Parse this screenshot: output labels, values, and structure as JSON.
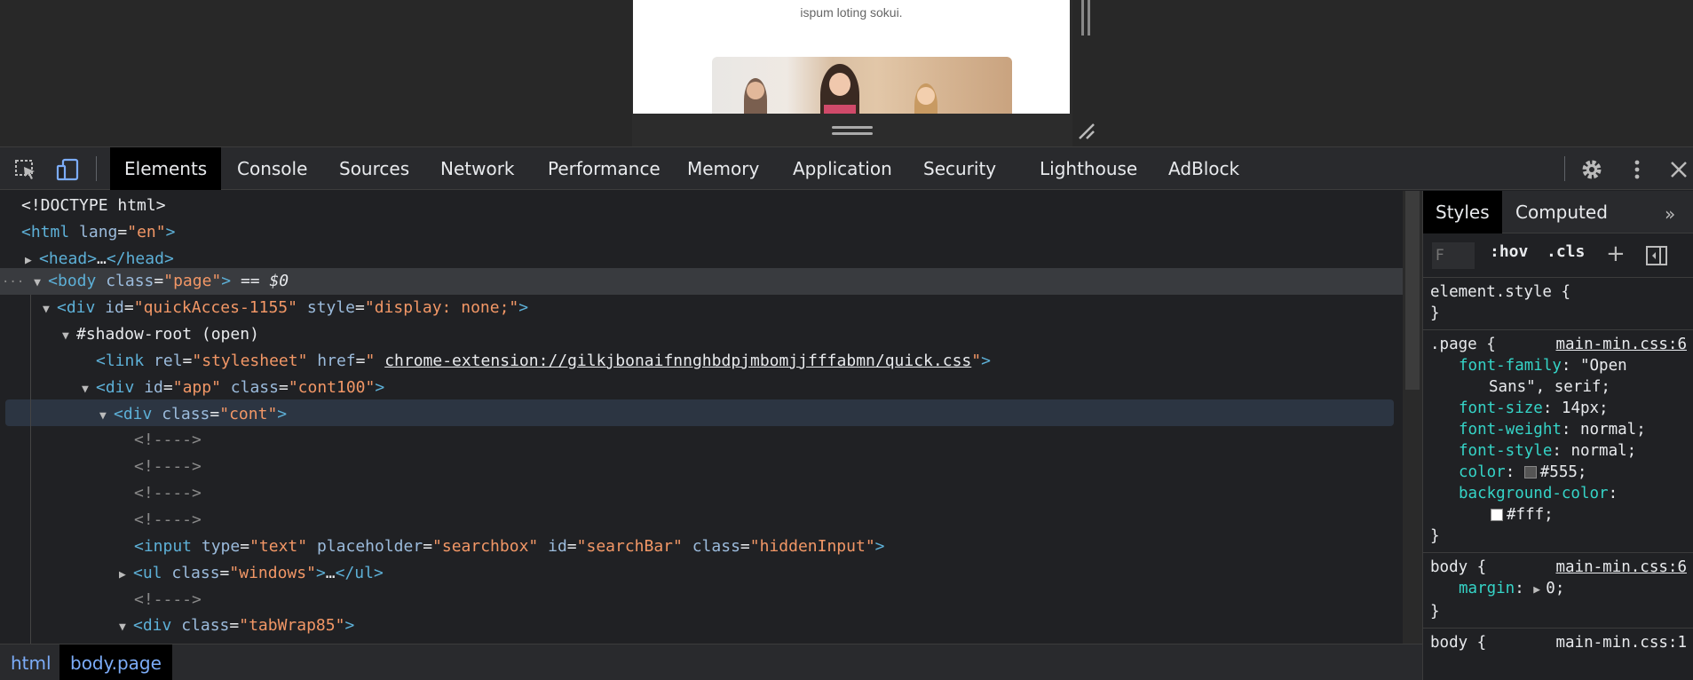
{
  "viewport": {
    "preview_text": "ispum loting sokui."
  },
  "toolbar": {
    "tabs": [
      "Elements",
      "Console",
      "Sources",
      "Network",
      "Performance",
      "Memory",
      "Application",
      "Security",
      "Lighthouse",
      "AdBlock"
    ],
    "active_tab": "Elements",
    "icons": [
      "inspect-element-icon",
      "device-toolbar-icon",
      "gear-icon",
      "kebab-menu-icon",
      "close-icon"
    ]
  },
  "dom": {
    "doctype": "<!DOCTYPE html>",
    "html_tag": "html",
    "html_attr": "lang",
    "html_val": "en",
    "head": "head",
    "body_tag": "body",
    "body_class_attr": "class",
    "body_class_val": "page",
    "body_marker": " == $0",
    "div1_id_attr": "id",
    "div1_id_val": "quickAcces-1155",
    "div1_style_attr": "style",
    "div1_style_val": "display: none;",
    "shadow_root": "#shadow-root (open)",
    "link_rel_attr": "rel",
    "link_rel_val": "stylesheet",
    "link_href_attr": "href",
    "link_href_val": "chrome-extension://gilkjbonaifnnghbdpjmbomjjfffabmn/quick.css",
    "app_id_attr": "id",
    "app_id_val": "app",
    "app_class_attr": "class",
    "app_class_val": "cont100",
    "cont_class_val": "cont",
    "comment": "<!---->",
    "input_type_attr": "type",
    "input_type_val": "text",
    "input_ph_attr": "placeholder",
    "input_ph_val": "searchbox",
    "input_id_attr": "id",
    "input_id_val": "searchBar",
    "input_class_attr": "class",
    "input_class_val": "hiddenInput",
    "ul_class_val": "windows",
    "tabwrap_class_val": "tabWrap85"
  },
  "breadcrumbs": [
    "html",
    "body.page"
  ],
  "styles": {
    "tabs": [
      "Styles",
      "Computed"
    ],
    "filter_placeholder": "F",
    "hov": ":hov",
    "cls": ".cls",
    "rules": {
      "element_style": "element.style {",
      "close": "}",
      "page_selector": ".page {",
      "page_source": "main-min.css:6",
      "font_family_prop": "font-family",
      "font_family_val1": "\"Open",
      "font_family_val2": "Sans\", serif;",
      "font_size_prop": "font-size",
      "font_size_val": "14px;",
      "font_weight_prop": "font-weight",
      "font_weight_val": "normal;",
      "font_style_prop": "font-style",
      "font_style_val": "normal;",
      "color_prop": "color",
      "color_val": "#555;",
      "bg_prop": "background-color",
      "bg_val": "#fff;",
      "body_selector": "body {",
      "body_source": "main-min.css:6",
      "margin_prop": "margin",
      "margin_val": "0;",
      "body2_selector": "body {",
      "body2_source": "main-min.css:1"
    },
    "swatch_colors": {
      "color": "#555555",
      "background": "#ffffff"
    }
  },
  "colors": {
    "tag": "#5db0d7",
    "attr": "#9bbbdc",
    "value": "#f29766",
    "property": "#35d4c7"
  }
}
